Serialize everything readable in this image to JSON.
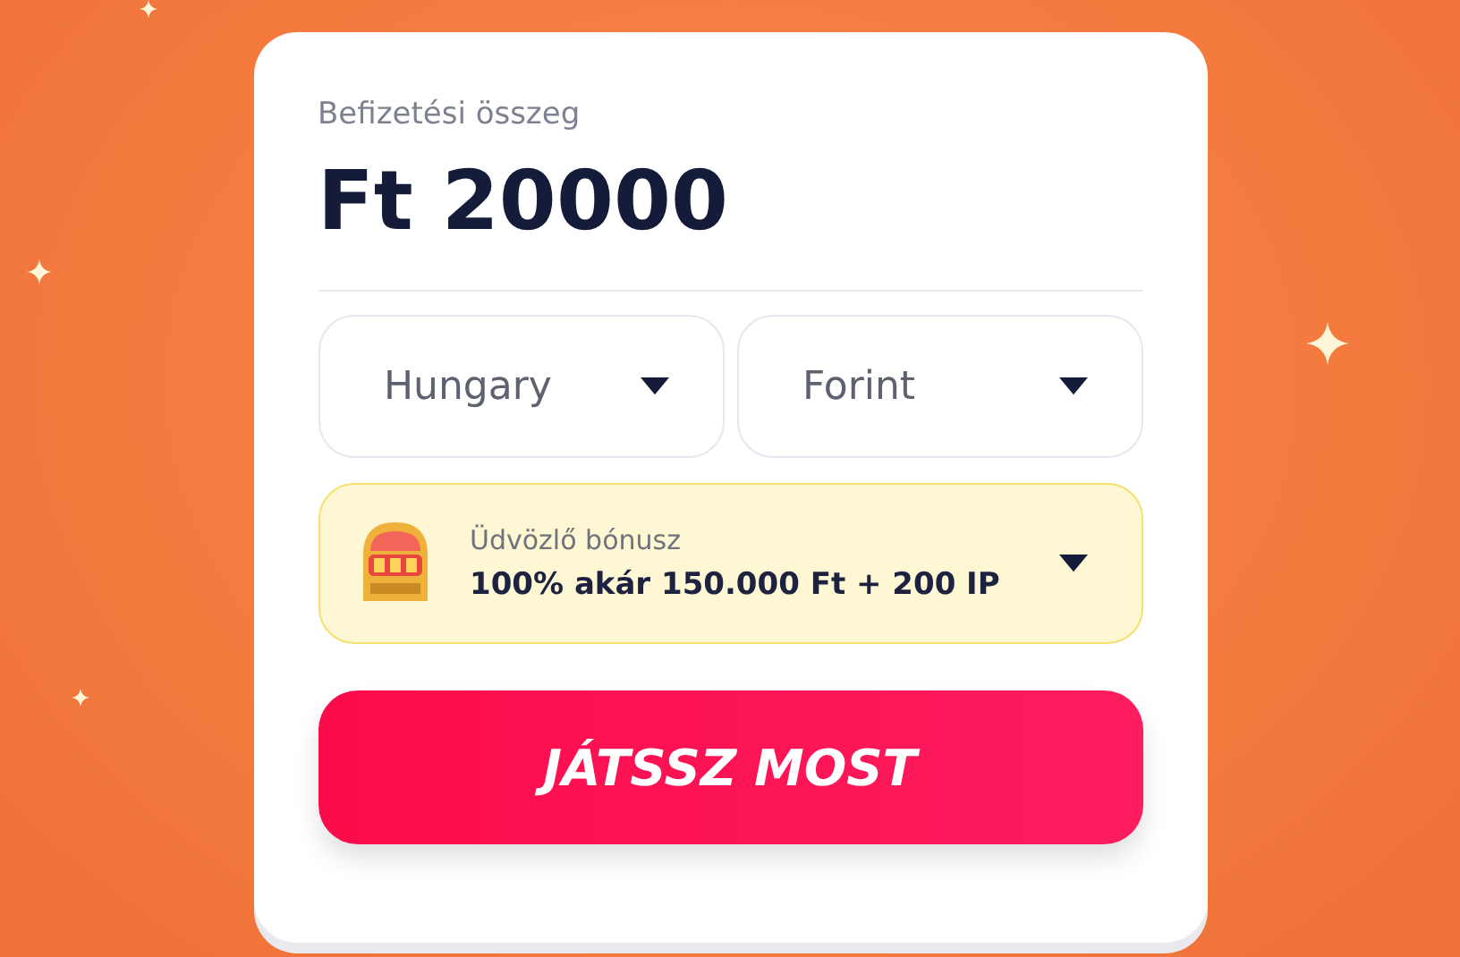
{
  "amount_label": "Befizetési összeg",
  "amount": "Ft 20000",
  "selects": [
    {
      "value": "Hungary"
    },
    {
      "value": "Forint"
    }
  ],
  "bonus": {
    "label": "Üdvözlő bónusz",
    "value": "100% akár 150.000 Ft + 200 IP"
  },
  "play_button": "JÁTSSZ MOST"
}
